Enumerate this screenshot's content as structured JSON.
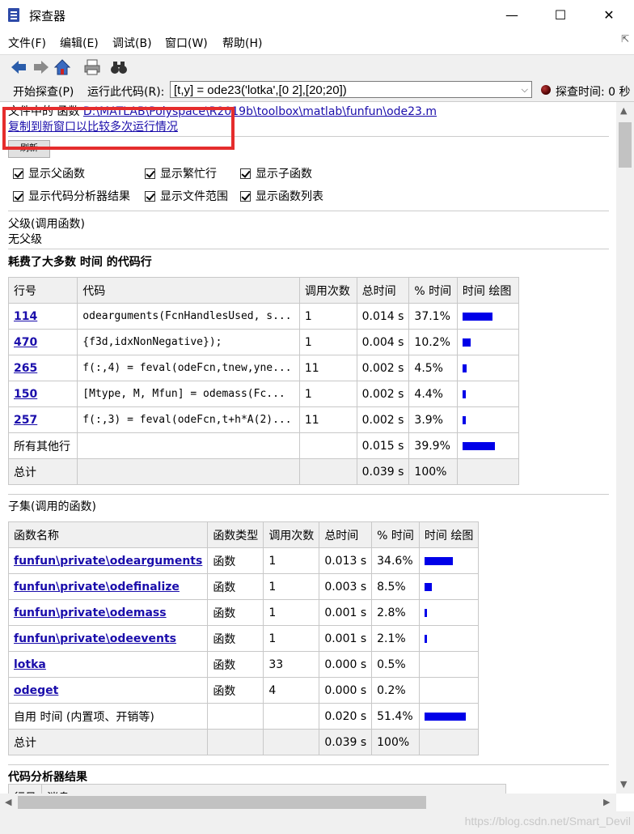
{
  "window": {
    "title": "探查器"
  },
  "menu": [
    "文件(F)",
    "编辑(E)",
    "调试(B)",
    "窗口(W)",
    "帮助(H)"
  ],
  "run": {
    "start_label": "开始探查(P)",
    "run_code_label": "运行此代码(R):",
    "command": "[t,y] = ode23('lotka',[0 2],[20;20])",
    "time_label": "探查时间: 0 秒"
  },
  "file_info": {
    "label": "文件中的 函数",
    "path": "D:\\MATLAB\\Polyspace\\R2019b\\toolbox\\matlab\\funfun\\ode23.m",
    "copy_link": "复制到新窗口以比较多次运行情况",
    "refresh_label": "刷新"
  },
  "options": [
    "显示父函数",
    "显示繁忙行",
    "显示子函数",
    "显示代码分析器结果",
    "显示文件范围",
    "显示函数列表"
  ],
  "parents": {
    "title": "父级(调用函数)",
    "value": "无父级"
  },
  "busy_lines": {
    "title": "耗费了大多数 时间 的代码行",
    "headers": [
      "行号",
      "代码",
      "调用次数",
      "总时间",
      "% 时间",
      "时间 绘图"
    ],
    "rows": [
      {
        "line": "114",
        "code": "odearguments(FcnHandlesUsed, s...",
        "calls": "1",
        "time": "0.014 s",
        "pct": "37.1%",
        "bar": 37.1
      },
      {
        "line": "470",
        "code": "{f3d,idxNonNegative});",
        "calls": "1",
        "time": "0.004 s",
        "pct": "10.2%",
        "bar": 10.2
      },
      {
        "line": "265",
        "code": "f(:,4) = feval(odeFcn,tnew,yne...",
        "calls": "11",
        "time": "0.002 s",
        "pct": "4.5%",
        "bar": 4.5
      },
      {
        "line": "150",
        "code": "[Mtype, M, Mfun] =  odemass(Fc...",
        "calls": "1",
        "time": "0.002 s",
        "pct": "4.4%",
        "bar": 4.4
      },
      {
        "line": "257",
        "code": "f(:,3) = feval(odeFcn,t+h*A(2)...",
        "calls": "11",
        "time": "0.002 s",
        "pct": "3.9%",
        "bar": 3.9
      }
    ],
    "other": {
      "label": "所有其他行",
      "time": "0.015 s",
      "pct": "39.9%",
      "bar": 39.9
    },
    "total": {
      "label": "总计",
      "time": "0.039 s",
      "pct": "100%"
    }
  },
  "children": {
    "title": "子集(调用的函数)",
    "headers": [
      "函数名称",
      "函数类型",
      "调用次数",
      "总时间",
      "% 时间",
      "时间 绘图"
    ],
    "rows": [
      {
        "name": "funfun\\private\\odearguments",
        "type": "函数",
        "calls": "1",
        "time": "0.013 s",
        "pct": "34.6%",
        "bar": 34.6
      },
      {
        "name": "funfun\\private\\odefinalize",
        "type": "函数",
        "calls": "1",
        "time": "0.003 s",
        "pct": "8.5%",
        "bar": 8.5
      },
      {
        "name": "funfun\\private\\odemass",
        "type": "函数",
        "calls": "1",
        "time": "0.001 s",
        "pct": "2.8%",
        "bar": 2.8
      },
      {
        "name": "funfun\\private\\odeevents",
        "type": "函数",
        "calls": "1",
        "time": "0.001 s",
        "pct": "2.1%",
        "bar": 2.1
      },
      {
        "name": "lotka",
        "type": "函数",
        "calls": "33",
        "time": "0.000 s",
        "pct": "0.5%",
        "bar": 0
      },
      {
        "name": "odeget",
        "type": "函数",
        "calls": "4",
        "time": "0.000 s",
        "pct": "0.2%",
        "bar": 0
      }
    ],
    "self": {
      "label": "自用 时间 (内置项、开销等)",
      "time": "0.020 s",
      "pct": "51.4%",
      "bar": 51.4
    },
    "total": {
      "label": "总计",
      "time": "0.039 s",
      "pct": "100%"
    }
  },
  "analyzer": {
    "title": "代码分析器结果",
    "headers": [
      "行号",
      "消息"
    ]
  },
  "watermark": "https://blog.csdn.net/Smart_Devil"
}
